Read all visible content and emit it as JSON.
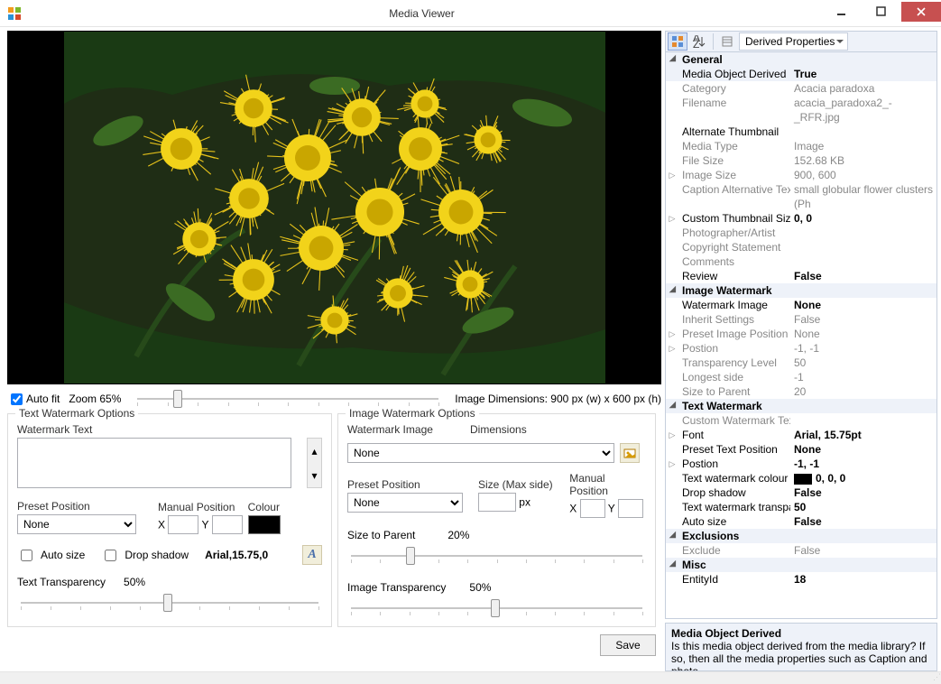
{
  "window": {
    "title": "Media Viewer"
  },
  "preview": {
    "auto_fit_label": "Auto fit",
    "auto_fit_checked": true,
    "zoom_label": "Zoom 65%",
    "dimensions_label": "Image Dimensions: 900 px (w) x 600 px (h)"
  },
  "text_watermark": {
    "legend": "Text Watermark Options",
    "watermark_text_label": "Watermark Text",
    "watermark_text_value": "",
    "preset_label": "Preset Position",
    "preset_value": "None",
    "manual_label": "Manual Position",
    "x_label": "X",
    "x_value": "",
    "y_label": "Y",
    "y_value": "",
    "colour_label": "Colour",
    "auto_size_label": "Auto size",
    "auto_size_checked": false,
    "drop_shadow_label": "Drop shadow",
    "drop_shadow_checked": false,
    "font_display": "Arial,15.75,0",
    "transparency_label": "Text Transparency",
    "transparency_value": "50%"
  },
  "image_watermark": {
    "legend": "Image Watermark Options",
    "image_label": "Watermark Image",
    "image_value": "None",
    "dimensions_label": "Dimensions",
    "preset_label": "Preset Position",
    "preset_value": "None",
    "size_label": "Size (Max side)",
    "size_value": "",
    "size_unit": "px",
    "manual_label": "Manual Position",
    "x_label": "X",
    "x_value": "",
    "y_label": "Y",
    "y_value": "",
    "size_to_parent_label": "Size to Parent",
    "size_to_parent_value": "20%",
    "transparency_label": "Image Transparency",
    "transparency_value": "50%"
  },
  "save_label": "Save",
  "props_toolbar": {
    "dropdown": "Derived Properties"
  },
  "props": {
    "sections": {
      "general": {
        "title": "General",
        "rows": [
          {
            "k": "Media Object Derived",
            "v": "True",
            "kstrong": true,
            "vstrong": true,
            "sel": true
          },
          {
            "k": "Category",
            "v": "Acacia paradoxa"
          },
          {
            "k": "Filename",
            "v": "acacia_paradoxa2_-_RFR.jpg"
          },
          {
            "k": "Alternate Thumbnail",
            "v": "",
            "kstrong": true
          },
          {
            "k": "Media Type",
            "v": "Image"
          },
          {
            "k": "File Size",
            "v": "152.68 KB"
          },
          {
            "k": "Image Size",
            "v": "900, 600",
            "exp": "▷"
          },
          {
            "k": "Caption Alternative Tex",
            "v": "small globular flower clusters (Ph"
          },
          {
            "k": "Custom Thumbnail Size",
            "v": "0, 0",
            "kstrong": true,
            "vstrong": true,
            "exp": "▷"
          },
          {
            "k": "Photographer/Artist",
            "v": ""
          },
          {
            "k": "Copyright Statement",
            "v": ""
          },
          {
            "k": "Comments",
            "v": ""
          },
          {
            "k": "Review",
            "v": "False",
            "kstrong": true,
            "vstrong": true
          }
        ]
      },
      "img_wm": {
        "title": "Image Watermark",
        "rows": [
          {
            "k": "Watermark Image",
            "v": "None",
            "kstrong": true,
            "vstrong": true
          },
          {
            "k": "Inherit Settings",
            "v": "False"
          },
          {
            "k": "Preset Image Position",
            "v": "None",
            "exp": "▷"
          },
          {
            "k": "Postion",
            "v": "-1, -1",
            "exp": "▷"
          },
          {
            "k": "Transparency Level",
            "v": "50"
          },
          {
            "k": "Longest side",
            "v": "-1"
          },
          {
            "k": "Size to Parent",
            "v": "20"
          }
        ]
      },
      "txt_wm": {
        "title": "Text Watermark",
        "rows": [
          {
            "k": "Custom Watermark Tex",
            "v": ""
          },
          {
            "k": "Font",
            "v": "Arial, 15.75pt",
            "kstrong": true,
            "vstrong": true,
            "exp": "▷"
          },
          {
            "k": "Preset Text Position",
            "v": "None",
            "kstrong": true,
            "vstrong": true
          },
          {
            "k": "Postion",
            "v": "-1, -1",
            "kstrong": true,
            "vstrong": true,
            "exp": "▷"
          },
          {
            "k": "Text watermark colour",
            "v": "0, 0, 0",
            "kstrong": true,
            "vstrong": true,
            "chip": "#000"
          },
          {
            "k": "Drop shadow",
            "v": "False",
            "kstrong": true,
            "vstrong": true
          },
          {
            "k": "Text watermark transpa",
            "v": "50",
            "kstrong": true,
            "vstrong": true
          },
          {
            "k": "Auto size",
            "v": "False",
            "kstrong": true,
            "vstrong": true
          }
        ]
      },
      "exclusions": {
        "title": "Exclusions",
        "rows": [
          {
            "k": "Exclude",
            "v": "False"
          }
        ]
      },
      "misc": {
        "title": "Misc",
        "rows": [
          {
            "k": "EntityId",
            "v": "18",
            "kstrong": true,
            "vstrong": true
          }
        ]
      }
    }
  },
  "description": {
    "heading": "Media Object Derived",
    "body": "Is this media object derived from the media library? If so, then all the media properties such as Caption and photo…"
  }
}
